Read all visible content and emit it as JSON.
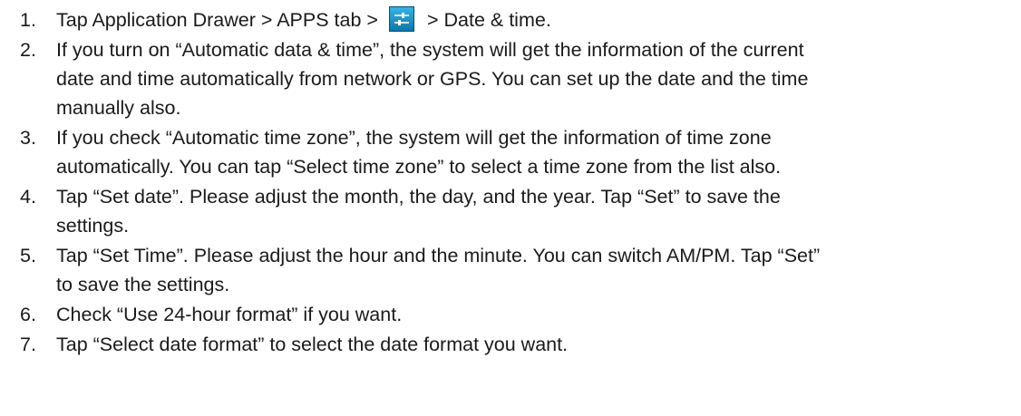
{
  "steps": [
    {
      "num": "1.",
      "text_before_icon": "Tap Application Drawer > APPS tab >",
      "icon": "settings-sliders-icon",
      "text_after_icon": "> Date & time."
    },
    {
      "num": "2.",
      "line1": "If you turn on “Automatic data & time”, the system will get the information of the current",
      "line2": "date and time automatically from network or GPS. You can set up the date and the time",
      "line3": "manually also."
    },
    {
      "num": "3.",
      "line1": "If you check “Automatic time zone”, the system will get the information of time zone",
      "line2": "automatically. You can tap “Select time zone” to select a time zone from the list also."
    },
    {
      "num": "4.",
      "line1": "Tap “Set date”. Please adjust the month, the day, and the year. Tap “Set” to save the",
      "line2": "settings."
    },
    {
      "num": "5.",
      "line1": "Tap “Set Time”. Please adjust the hour and the minute. You can switch AM/PM. Tap “Set”",
      "line2": "to save the settings."
    },
    {
      "num": "6.",
      "line1": "Check “Use 24-hour format” if you want."
    },
    {
      "num": "7.",
      "line1": "Tap “Select date format” to select the date format you want."
    }
  ],
  "colors": {
    "icon_top": "#33b5e5",
    "icon_bottom": "#0f76a8"
  }
}
